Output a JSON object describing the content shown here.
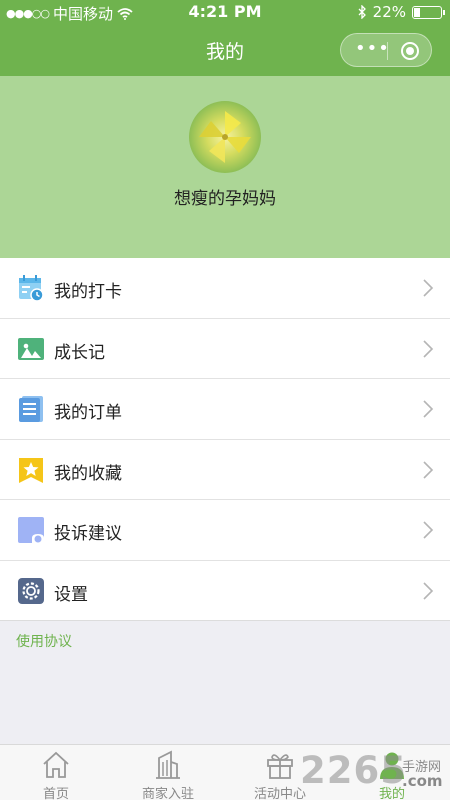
{
  "status_bar": {
    "signal": "●●●○○",
    "carrier": "中国移动",
    "time": "4:21 PM",
    "battery_text": "22%",
    "battery_level": 0.22
  },
  "nav": {
    "title": "我的",
    "capsule_dots": "•••"
  },
  "profile": {
    "nickname": "想瘦的孕妈妈"
  },
  "menu": [
    {
      "label": "我的打卡",
      "icon": "calendar-check-icon",
      "color": "#7ec6f0"
    },
    {
      "label": "成长记",
      "icon": "picture-icon",
      "color": "#4fb27b"
    },
    {
      "label": "我的订单",
      "icon": "document-list-icon",
      "color": "#5a9be0"
    },
    {
      "label": "我的收藏",
      "icon": "star-bookmark-icon",
      "color": "#f5c518"
    },
    {
      "label": "投诉建议",
      "icon": "feedback-icon",
      "color": "#8fa6f0"
    },
    {
      "label": "设置",
      "icon": "gear-icon",
      "color": "#55688c"
    }
  ],
  "agreement_link": "使用协议",
  "tabs": [
    {
      "label": "首页",
      "icon": "home-icon",
      "active": false
    },
    {
      "label": "商家入驻",
      "icon": "building-icon",
      "active": false
    },
    {
      "label": "活动中心",
      "icon": "gift-icon",
      "active": false
    },
    {
      "label": "我的",
      "icon": "person-icon",
      "active": true
    }
  ],
  "watermark": {
    "number": "2265",
    "text": "手游网",
    "suffix": ".com"
  },
  "colors": {
    "accent": "#6fb34e",
    "profile_bg": "#acd696",
    "page_bg": "#eeeef3"
  }
}
